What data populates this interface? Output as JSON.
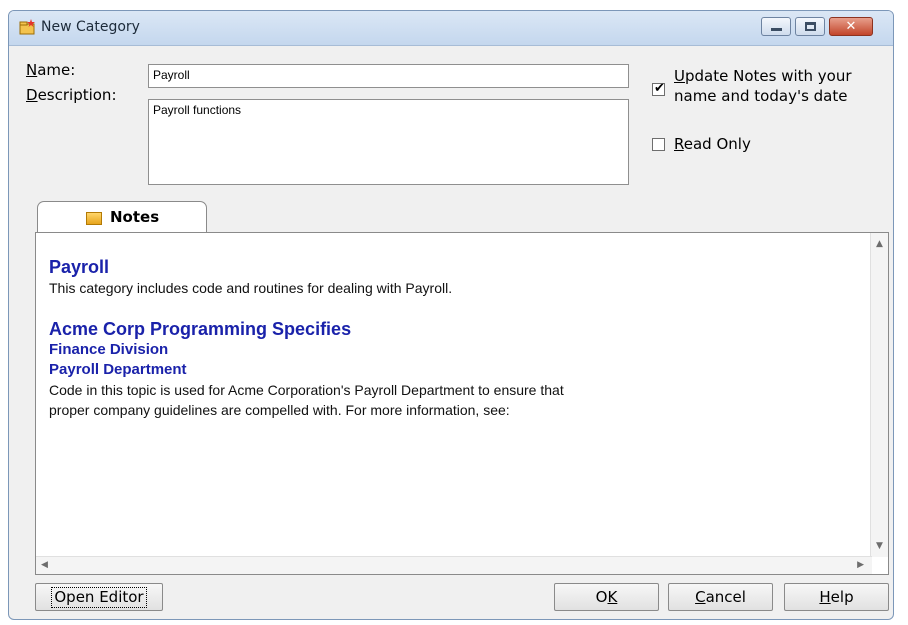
{
  "window": {
    "title": "New Category",
    "controls": {
      "minimize": "minimize",
      "maximize": "maximize",
      "close": "✕"
    }
  },
  "form": {
    "name_label": "Name:",
    "name_value": "Payroll",
    "description_label": "Description:",
    "description_value": "Payroll functions",
    "update_notes_label_line1": "Update Notes with your",
    "update_notes_label_line2": "name and today's date",
    "update_notes_checked": true,
    "read_only_label": "Read Only",
    "read_only_checked": false
  },
  "tabs": [
    {
      "label": "Notes",
      "icon": "notes-icon",
      "active": true
    }
  ],
  "notes": {
    "heading": "Payroll",
    "intro": "This category includes code and routines for dealing with Payroll.",
    "section_heading": "Acme Corp Programming Specifies",
    "division": "Finance Division",
    "department": "Payroll Department",
    "body_line1": "Code in this topic is used for Acme Corporation's Payroll Department to ensure that",
    "body_line2": "proper company guidelines are compelled with. For more information, see:"
  },
  "buttons": {
    "open_editor": "Open Editor",
    "ok": "OK",
    "cancel": "Cancel",
    "help": "Help"
  },
  "colors": {
    "heading_blue": "#1a22aa",
    "dialog_bg": "#f0f0f0",
    "close_red": "#c2452a"
  }
}
